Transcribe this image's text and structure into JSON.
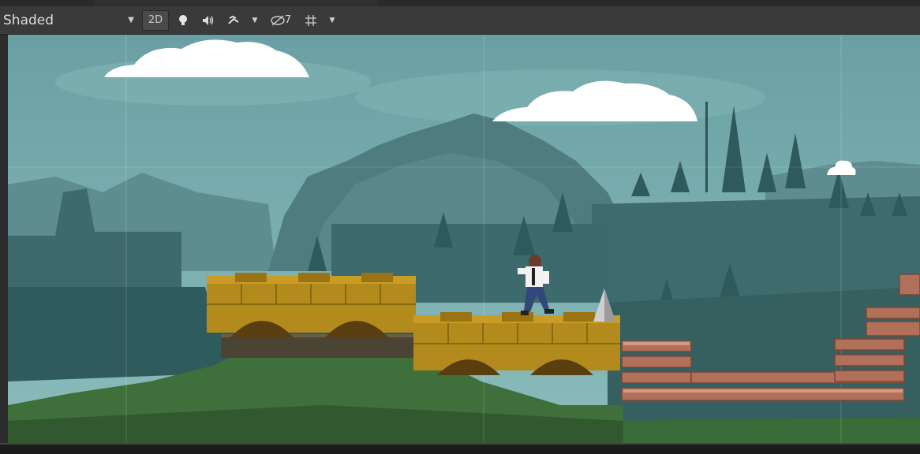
{
  "toolbar": {
    "draw_mode": "Shaded",
    "btn_2d": "2D",
    "gizmo_count": "7",
    "icons": [
      "lightbulb-icon",
      "audio-icon",
      "effects-icon",
      "hidden-objects-icon",
      "grid-icon"
    ]
  },
  "colors": {
    "sky": "#6fa3a3",
    "bridge": "#b38a1c",
    "brick": "#b0705a",
    "toolbar": "#3a3a3a"
  }
}
